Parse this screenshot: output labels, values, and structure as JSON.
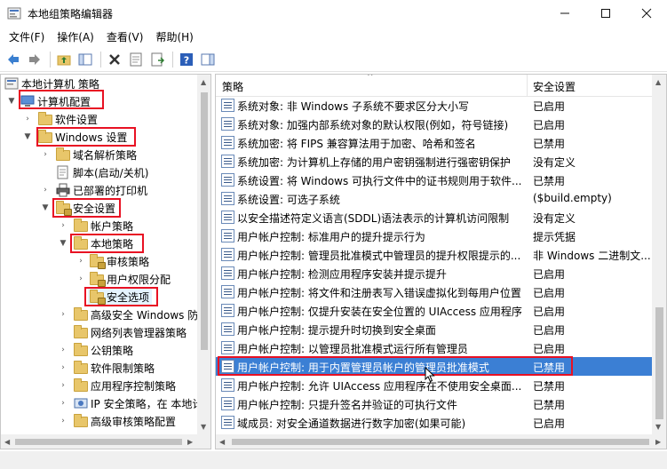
{
  "window": {
    "title": "本地组策略编辑器"
  },
  "menu": [
    {
      "label": "文件(F)"
    },
    {
      "label": "操作(A)"
    },
    {
      "label": "查看(V)"
    },
    {
      "label": "帮助(H)"
    }
  ],
  "toolbar": [
    "back-icon",
    "forward-icon",
    "up-folder-icon",
    "show-hide-tree-icon",
    "delete-icon",
    "properties-icon",
    "export-list-icon",
    "help-icon",
    "action-pane-icon"
  ],
  "tree": {
    "items": [
      {
        "label": "本地计算机 策略",
        "icon": "computer-policy-icon"
      },
      {
        "label": "计算机配置",
        "icon": "computer-icon"
      },
      {
        "label": "软件设置",
        "icon": "folder-icon"
      },
      {
        "label": "Windows 设置",
        "icon": "folder-icon"
      },
      {
        "label": "域名解析策略",
        "icon": "folder-icon"
      },
      {
        "label": "脚本(启动/关机)",
        "icon": "script-icon"
      },
      {
        "label": "已部署的打印机",
        "icon": "printer-icon"
      },
      {
        "label": "安全设置",
        "icon": "security-folder-icon"
      },
      {
        "label": "帐户策略",
        "icon": "folder-icon"
      },
      {
        "label": "本地策略",
        "icon": "folder-icon"
      },
      {
        "label": "审核策略",
        "icon": "lock-folder-icon"
      },
      {
        "label": "用户权限分配",
        "icon": "lock-folder-icon"
      },
      {
        "label": "安全选项",
        "icon": "lock-folder-icon"
      },
      {
        "label": "高级安全 Windows 防",
        "icon": "folder-icon"
      },
      {
        "label": "网络列表管理器策略",
        "icon": "folder-icon"
      },
      {
        "label": "公钥策略",
        "icon": "folder-icon"
      },
      {
        "label": "软件限制策略",
        "icon": "folder-icon"
      },
      {
        "label": "应用程序控制策略",
        "icon": "folder-icon"
      },
      {
        "label": "IP 安全策略，在 本地计",
        "icon": "ipsec-icon"
      },
      {
        "label": "高级审核策略配置",
        "icon": "folder-icon"
      }
    ]
  },
  "list": {
    "columns": {
      "policy": "策略",
      "setting": "安全设置"
    },
    "rows": [
      {
        "policy": "系统对象: 非 Windows 子系统不要求区分大小写",
        "setting": "已启用"
      },
      {
        "policy": "系统对象: 加强内部系统对象的默认权限(例如，符号链接)",
        "setting": "已启用"
      },
      {
        "policy": "系统加密: 将 FIPS 兼容算法用于加密、哈希和签名",
        "setting": "已禁用"
      },
      {
        "policy": "系统加密: 为计算机上存储的用户密钥强制进行强密钥保护",
        "setting": "没有定义"
      },
      {
        "policy": "系统设置: 将 Windows 可执行文件中的证书规则用于软件...",
        "setting": "已禁用"
      },
      {
        "policy": "系统设置: 可选子系统",
        "setting": "($build.empty)"
      },
      {
        "policy": "以安全描述符定义语言(SDDL)语法表示的计算机访问限制",
        "setting": "没有定义"
      },
      {
        "policy": "用户帐户控制: 标准用户的提升提示行为",
        "setting": "提示凭据"
      },
      {
        "policy": "用户帐户控制: 管理员批准模式中管理员的提升权限提示的...",
        "setting": "非 Windows 二进制文..."
      },
      {
        "policy": "用户帐户控制: 检测应用程序安装并提示提升",
        "setting": "已启用"
      },
      {
        "policy": "用户帐户控制: 将文件和注册表写入错误虚拟化到每用户位置",
        "setting": "已启用"
      },
      {
        "policy": "用户帐户控制: 仅提升安装在安全位置的 UIAccess 应用程序",
        "setting": "已启用"
      },
      {
        "policy": "用户帐户控制: 提示提升时切换到安全桌面",
        "setting": "已启用"
      },
      {
        "policy": "用户帐户控制: 以管理员批准模式运行所有管理员",
        "setting": "已启用"
      },
      {
        "policy": "用户帐户控制: 用于内置管理员帐户的管理员批准模式",
        "setting": "已禁用"
      },
      {
        "policy": "用户帐户控制: 允许 UIAccess 应用程序在不使用安全桌面...",
        "setting": "已禁用"
      },
      {
        "policy": "用户帐户控制: 只提升签名并验证的可执行文件",
        "setting": "已禁用"
      },
      {
        "policy": "域成员: 对安全通道数据进行数字加密(如果可能)",
        "setting": "已启用"
      }
    ]
  },
  "colors": {
    "selection": "#3b7fd4",
    "highlight": "#e81123",
    "folder": "#e8c66a"
  }
}
